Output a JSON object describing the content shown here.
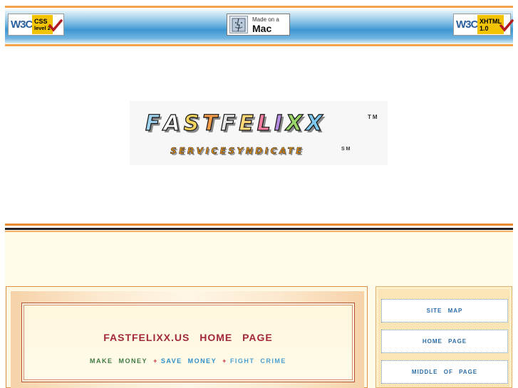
{
  "badges": {
    "css": {
      "logo": "W3C",
      "line1": "CSS",
      "line2": "level 2"
    },
    "mac": {
      "line1": "Made on a",
      "line2": "Mac"
    },
    "xhtml": {
      "logo": "W3C",
      "line1": "XHTML",
      "line2": "1.0"
    }
  },
  "logo": {
    "main_letters": [
      "F",
      "A",
      "S",
      "T",
      "F",
      "E",
      "L",
      "I",
      "X",
      "X"
    ],
    "main_colors": [
      "#9fd3f0",
      "#ffffff",
      "#f4d35e",
      "#f39c4a",
      "#e8e8e8",
      "#ffd87a",
      "#f47ea0",
      "#b48be0",
      "#9bd66a",
      "#7fc8f0"
    ],
    "tm": "TM",
    "sub": "SERVICESYNDICATE",
    "sm": "SM"
  },
  "main": {
    "title": "FASTFELIXX.US HOME PAGE",
    "tagline": {
      "part1": "MAKE MONEY",
      "plus": "+",
      "part2": "SAVE MONEY",
      "part3": "FIGHT CRIME"
    }
  },
  "sidebar": {
    "items": [
      {
        "label": "SITE MAP"
      },
      {
        "label": "HOME PAGE"
      },
      {
        "label": "MIDDLE OF PAGE"
      }
    ]
  }
}
